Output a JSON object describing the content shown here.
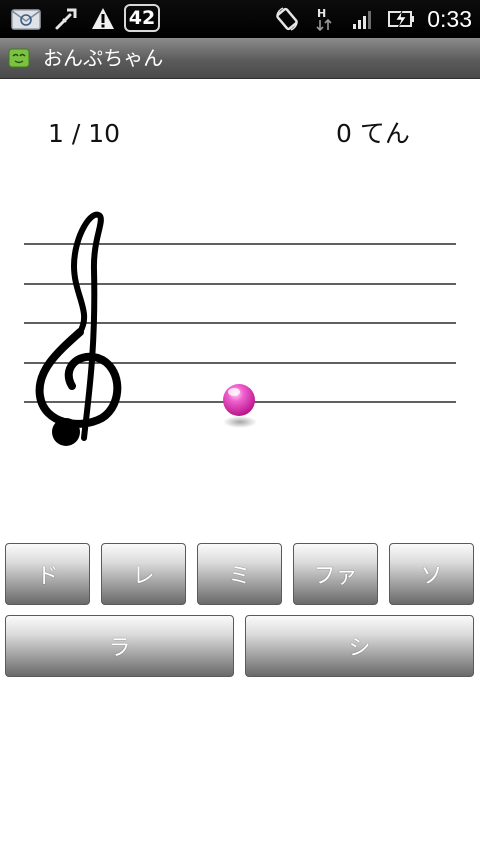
{
  "status_bar": {
    "notification_count": "42",
    "clock": "0:33",
    "icons": [
      "email-icon",
      "usb-debug-icon",
      "warning-icon",
      "rotation-icon",
      "hspa-data-icon",
      "signal-icon",
      "battery-charging-icon"
    ]
  },
  "title_bar": {
    "app_icon": "app-icon",
    "title": "おんぷちゃん"
  },
  "game": {
    "question_counter": "1 / 10",
    "score": "0 てん"
  },
  "answer_buttons": {
    "row1": [
      "ド",
      "レ",
      "ミ",
      "ファ",
      "ソ"
    ],
    "row2": [
      "ラ",
      "シ"
    ]
  },
  "colors": {
    "note": "#e23fb8",
    "title_bar": "#6a6a6a",
    "status_bar": "#000000"
  }
}
